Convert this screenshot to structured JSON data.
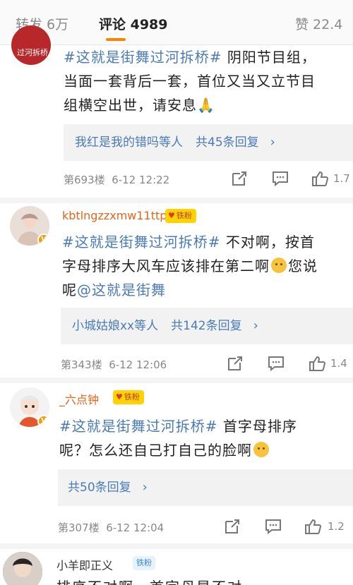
{
  "tabs": {
    "repost": "转发 6万",
    "comments": "评论 4989",
    "likes": "赞 22.4"
  },
  "comments": [
    {
      "avatar_label": "过河拆桥",
      "hashtag": "#这就是街舞过河拆桥#",
      "text_after": "阴阳节目组，当面一套背后一套，首位又当又立节目组横空出世，请安息🙏",
      "line1_rest": " 阴阳节目组，",
      "line2": "当面一套背后一套，首位又当又立节目",
      "line3": "组横空出世，请安息🙏",
      "reply_names": "我红是我的错吗等人",
      "reply_count": "共45条回复",
      "floor": "第693楼",
      "time": "6-12 12:22",
      "like_count": "1.7"
    },
    {
      "username": "kbtlngzzxmw11ttp",
      "fan_badge": "铁粉",
      "hashtag": "#这就是街舞过河拆桥#",
      "line1_rest": " 不对啊，按首",
      "line2_a": "字母排序大风车应该排在第二啊",
      "line2_b": "您说",
      "line3_a": "呢",
      "mention": "@这就是街舞",
      "reply_names": "小城姑娘xx等人",
      "reply_count": "共142条回复",
      "floor": "第343楼",
      "time": "6-12 12:06",
      "like_count": "1.4"
    },
    {
      "username": "_六点钟",
      "fan_badge": "铁粉",
      "hashtag": "#这就是街舞过河拆桥#",
      "line1_rest": " 首字母排序",
      "line2": "呢？怎么还自己打自己的脸啊",
      "reply_count": "共50条回复",
      "floor": "第307楼",
      "time": "6-12 12:04",
      "like_count": "1.2"
    },
    {
      "username": "小羊即正义",
      "fan_badge": "铁粉",
      "partial_text": "排序不对啊，首字母是不对"
    }
  ],
  "icons": {
    "share": "share-icon",
    "comment": "comment-icon",
    "like": "thumbs-up-icon",
    "chevron": "chevron-right-icon"
  },
  "colors": {
    "accent": "#ff8200",
    "link": "#4a7bb7",
    "username": "#e8641b"
  }
}
